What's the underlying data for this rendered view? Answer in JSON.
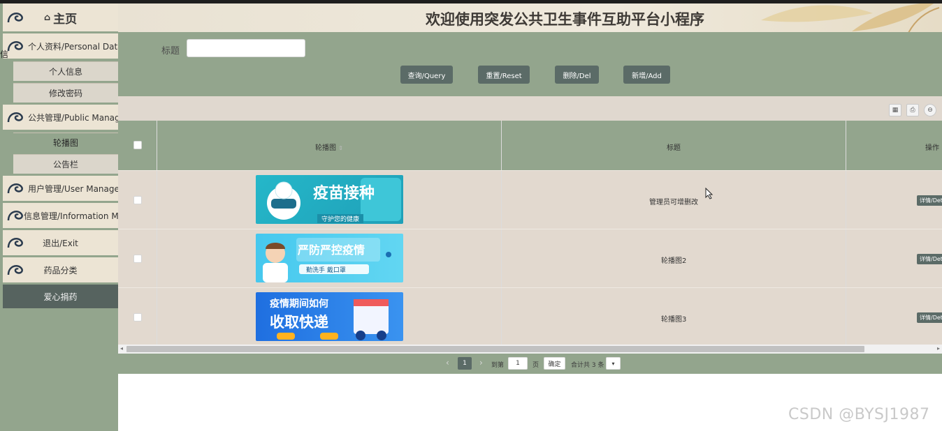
{
  "header": {
    "title": "欢迎使用突发公共卫生事件互助平台小程序"
  },
  "sidebar": {
    "home_icon": "home-icon",
    "home_label": "主页",
    "groups": [
      {
        "label": "个人资料/Personal Data"
      },
      {
        "label": "公共管理/Public Management"
      },
      {
        "label": "用户管理/User Management"
      },
      {
        "label": "信息管理/Information Management"
      }
    ],
    "personal_items": [
      "个人信息",
      "修改密码"
    ],
    "public_items": [
      "轮播图",
      "公告栏"
    ],
    "exit_label": "退出/Exit",
    "drug_category_label": "药品分类",
    "donation_label": "爱心捐药",
    "side_glyph": "信"
  },
  "search": {
    "title_label": "标题",
    "title_value": "",
    "buttons": {
      "query": "查询/Query",
      "reset": "重置/Reset",
      "delete": "删除/Del",
      "add": "新增/Add"
    }
  },
  "toolbar": {
    "icons": [
      "columns-icon",
      "print-icon",
      "export-icon"
    ]
  },
  "table": {
    "columns": [
      "轮播图",
      "标题",
      "操作"
    ],
    "rows": [
      {
        "title": "管理员可增删改",
        "action": "详情/Detail",
        "banner": {
          "text": "疫苗接种",
          "subtitle": "守护您的健康"
        }
      },
      {
        "title": "轮播图2",
        "action": "详情/Detail",
        "banner": {
          "text": "严防严控疫情",
          "subtitle": "勤洗手 戴口罩"
        }
      },
      {
        "title": "轮播图3",
        "action": "详情/Detail",
        "banner": {
          "text": "疫情期间如何",
          "subtitle": "收取快递"
        }
      }
    ]
  },
  "pager": {
    "prev": "‹",
    "current_page": "1",
    "next": "›",
    "goto_label": "到第",
    "goto_value": "1",
    "page_unit": "页",
    "confirm": "确定",
    "total": "合计共 3 条"
  },
  "colors": {
    "sage": "#93a58d",
    "dark_button": "#5b6b67",
    "beige": "#e2d9cf",
    "cream": "#ece4d4"
  },
  "watermark": "CSDN @BYSJ1987"
}
